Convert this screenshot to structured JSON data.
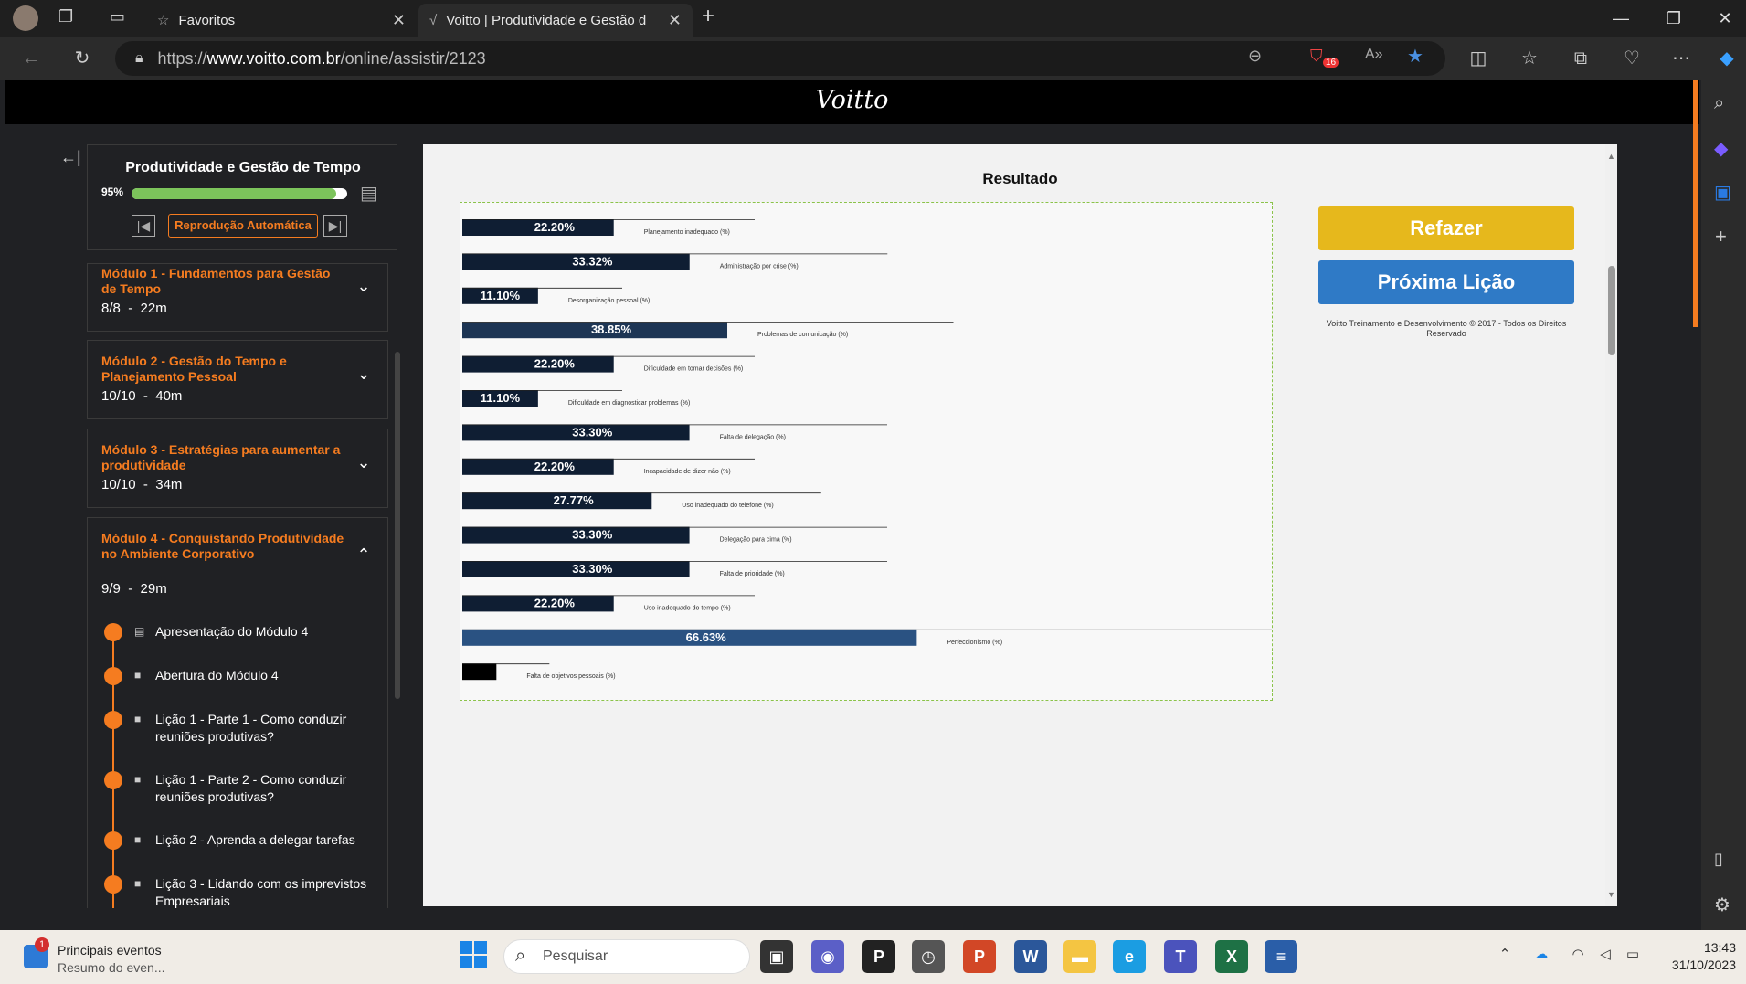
{
  "browser": {
    "tabs": [
      {
        "title": "Favoritos"
      },
      {
        "title": "Voitto | Produtividade e Gestão d"
      }
    ],
    "url_prefix": "https://",
    "url_host": "www.voitto.com.br",
    "url_path": "/online/assistir/2123",
    "tracker_badge": "16"
  },
  "site": {
    "logo": "Voitto"
  },
  "sidebar": {
    "course_title": "Produtividade e Gestão de Tempo",
    "progress_label": "95%",
    "progress": 0.95,
    "autoplay_label": "Reprodução Automática",
    "modules": [
      {
        "title": "Módulo 1 - Fundamentos para Gestão de Tempo",
        "count": "8/8",
        "sep": "-",
        "duration": "22m"
      },
      {
        "title": "Módulo 2 - Gestão do Tempo e Planejamento Pessoal",
        "count": "10/10",
        "sep": "-",
        "duration": "40m"
      },
      {
        "title": "Módulo 3 - Estratégias para aumentar a produtividade",
        "count": "10/10",
        "sep": "-",
        "duration": "34m"
      },
      {
        "title": "Módulo 4 - Conquistando Produtividade no Ambiente Corporativo",
        "count": "9/9",
        "sep": "-",
        "duration": "29m"
      }
    ],
    "lessons": [
      {
        "label": "Apresentação do Módulo 4",
        "icon": "slides-icon"
      },
      {
        "label": "Abertura do Módulo 4",
        "icon": "video-icon"
      },
      {
        "label": "Lição 1 - Parte 1 - Como conduzir reuniões produtivas?",
        "icon": "video-icon"
      },
      {
        "label": "Lição 1 - Parte 2 - Como conduzir reuniões produtivas?",
        "icon": "video-icon"
      },
      {
        "label": "Lição 2 - Aprenda a delegar tarefas",
        "icon": "video-icon"
      },
      {
        "label": "Lição 3 - Lidando com os imprevistos Empresariais",
        "icon": "video-icon"
      }
    ]
  },
  "main": {
    "result_title": "Resultado",
    "refazer_label": "Refazer",
    "proxima_label": "Próxima Lição",
    "copyright": "Voitto Treinamento e Desenvolvimento © 2017 - Todos os Direitos Reservado"
  },
  "chart_data": {
    "type": "bar",
    "orientation": "horizontal",
    "categories": [
      "Planejamento inadequado (%)",
      "Administração por crise (%)",
      "Desorganização pessoal (%)",
      "Problemas de comunicação (%)",
      "Dificuldade em tomar decisões (%)",
      "Dificuldade em diagnosticar problemas (%)",
      "Falta de delegação (%)",
      "Incapacidade de dizer não (%)",
      "Uso inadequado do telefone (%)",
      "Delegação para cima (%)",
      "Falta de prioridade (%)",
      "Uso inadequado do tempo (%)",
      "Perfeccionismo (%)",
      "Falta de objetivos pessoais (%)"
    ],
    "values": [
      22.2,
      33.32,
      11.1,
      38.85,
      22.2,
      11.1,
      33.3,
      22.2,
      27.77,
      33.3,
      33.3,
      22.2,
      66.63,
      5.0
    ],
    "value_labels": [
      "22.20%",
      "33.32%",
      "11.10%",
      "38.85%",
      "22.20%",
      "11.10%",
      "33.30%",
      "22.20%",
      "27.77%",
      "33.30%",
      "33.30%",
      "22.20%",
      "66.63%",
      ""
    ],
    "highlight_colors": {
      "default": "#0f1e33",
      "mid": "#1d3554",
      "top": "#2a5282",
      "min": "#000000"
    },
    "xlim": [
      0,
      100
    ]
  },
  "taskbar": {
    "news_badge": "1",
    "news_title": "Principais eventos",
    "news_sub": "Resumo do even...",
    "search_placeholder": "Pesquisar",
    "time": "13:43",
    "date": "31/10/2023"
  }
}
